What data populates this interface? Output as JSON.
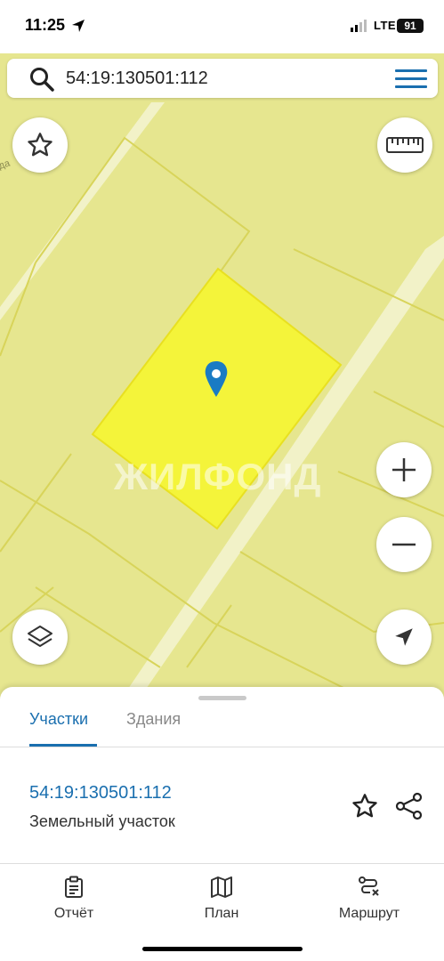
{
  "status_bar": {
    "time": "11:25",
    "network": "LTE",
    "battery": "91"
  },
  "search": {
    "value": "54:19:130501:112"
  },
  "map": {
    "watermark": "ЖИЛФОНД",
    "edge_label": "ода",
    "colors": {
      "background": "#e6e68f",
      "selected_parcel": "#f4f43a",
      "accent": "#1a6faf"
    }
  },
  "sheet": {
    "tabs": [
      {
        "label": "Участки",
        "active": true
      },
      {
        "label": "Здания",
        "active": false
      }
    ],
    "plot": {
      "number": "54:19:130501:112",
      "type": "Земельный участок"
    }
  },
  "bottom_nav": {
    "items": [
      {
        "label": "Отчёт",
        "icon": "clipboard-icon"
      },
      {
        "label": "План",
        "icon": "map-icon"
      },
      {
        "label": "Маршрут",
        "icon": "route-icon"
      }
    ]
  }
}
